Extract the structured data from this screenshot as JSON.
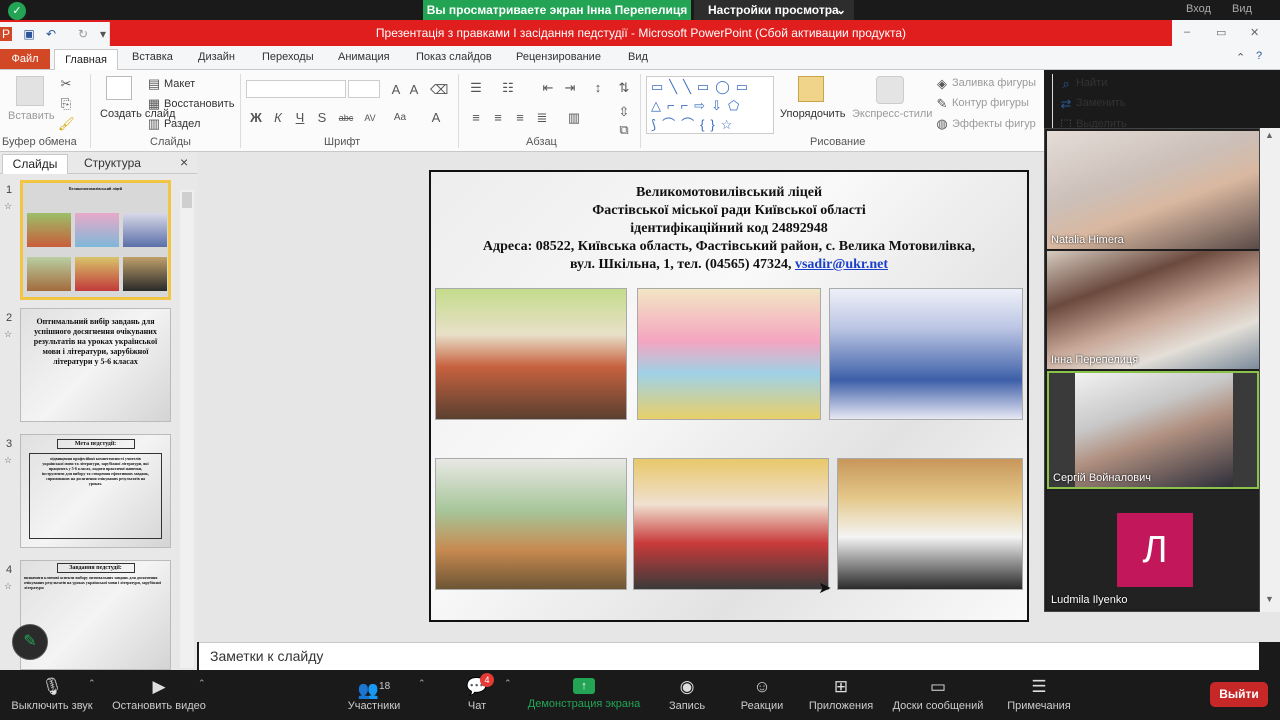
{
  "zoom": {
    "banner": "Вы просматриваете экран Інна Перепелиця",
    "view_settings": "Настройки просмотра",
    "login": "Вход",
    "view": "Вид",
    "toolbar": {
      "mute": "Выключить звук",
      "stop_video": "Остановить видео",
      "participants": "Участники",
      "participants_count": "18",
      "chat": "Чат",
      "chat_badge": "4",
      "share": "Демонстрация экрана",
      "record": "Запись",
      "reactions": "Реакции",
      "apps": "Приложения",
      "whiteboards": "Доски сообщений",
      "notes": "Примечания",
      "leave": "Выйти"
    },
    "participants": [
      {
        "name": "Natalia Himera"
      },
      {
        "name": "Інна Перепелиця"
      },
      {
        "name": "Сергій Войналович"
      },
      {
        "name": "Ludmila Ilyenko",
        "initial": "Л",
        "avatar_color": "#c2185b"
      }
    ]
  },
  "ppt": {
    "title": "Презентація з правками І засідання педстудії  -  Microsoft PowerPoint (Сбой активации продукта)",
    "tabs": [
      "Файл",
      "Главная",
      "Вставка",
      "Дизайн",
      "Переходы",
      "Анимация",
      "Показ слайдов",
      "Рецензирование",
      "Вид"
    ],
    "ribbon": {
      "paste": "Вставить",
      "clipboard_group": "Буфер обмена",
      "new_slide": "Создать слайд",
      "layout": "Макет",
      "reset": "Восстановить",
      "section": "Раздел",
      "slides_group": "Слайды",
      "font_group": "Шрифт",
      "paragraph_group": "Абзац",
      "arrange": "Упорядочить",
      "quick_styles": "Экспресс-стили",
      "shape_fill": "Заливка фигуры",
      "shape_outline": "Контур фигуры",
      "shape_effects": "Эффекты фигур",
      "drawing_group": "Рисование",
      "find": "Найти",
      "replace": "Заменить",
      "select": "Выделить",
      "font_buttons": [
        "Ж",
        "К",
        "Ч",
        "S",
        "abc",
        "AV",
        "Aa",
        "A"
      ]
    },
    "pane_tabs": [
      "Слайды",
      "Структура"
    ],
    "pane_close": "×",
    "thumbnails": [
      {
        "num": "1",
        "text": "Великомотовилівський ліцей"
      },
      {
        "num": "2",
        "text": "Оптимальний вибір завдань для успішного досягнення очікуваних результатів на уроках української мови і літератури, зарубіжної літератури у 5-6 класах"
      },
      {
        "num": "3",
        "title": "Мета педстудії:",
        "text": "підвищення професійної компетентності учителів української мови та літератури, зарубіжної літератури, які працюють у 5-6 класах, надати практичні навички, інструменти для вибору та створення ефективних завдань, спрямованих на досягнення очікуваних результатів на уроках."
      },
      {
        "num": "4",
        "title": "Завдання педстудії:",
        "text": "визначити ключові аспекти вибору оптимальних завдань для досягнення очікуваних результатів на уроках української мови і літератури, зарубіжної літератури"
      }
    ],
    "slide": {
      "lines": [
        "Великомотовилівський ліцей",
        "Фастівської міської  ради Київської області",
        "ідентифікаційний код 24892948",
        "Адреса: 08522, Київська область, Фастівський район, с. Велика Мотовилівка,"
      ],
      "address_line_prefix": "вул. Шкільна, 1, тел. (04565) 47324, ",
      "email": "vsadir@ukr.net"
    },
    "notes_placeholder": "Заметки к слайду"
  }
}
